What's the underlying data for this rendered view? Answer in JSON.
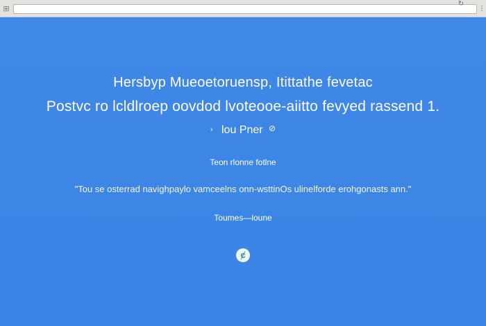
{
  "browser": {
    "logo_icon": "⊞",
    "address_value": "",
    "reload_icon": "↻",
    "menu_icon": "⋮"
  },
  "page": {
    "headline": "Hersbyp  Mueoetoruensp, Itittathe fevetac",
    "subline": "Postvc ro lcldlroep oovdod lvoteooe-aiitto  fevyed rassend 1.",
    "cta_arrow": "›",
    "cta_label": "lou Pner",
    "cta_icon": "⊘",
    "caption": "Teon rlonne fotlne",
    "quote": "\"Tou se osterrad navighpaylo vamceelns onn-wsttinOs ulinelforde erohgonasts ann.\"",
    "footer_link": "Toumes—loune",
    "badge_glyph": "ȼ"
  },
  "colors": {
    "background": "#3d86e6",
    "toolbar": "#e4e2de",
    "text": "#ffffff",
    "badge_fg": "#2a9a8c"
  }
}
